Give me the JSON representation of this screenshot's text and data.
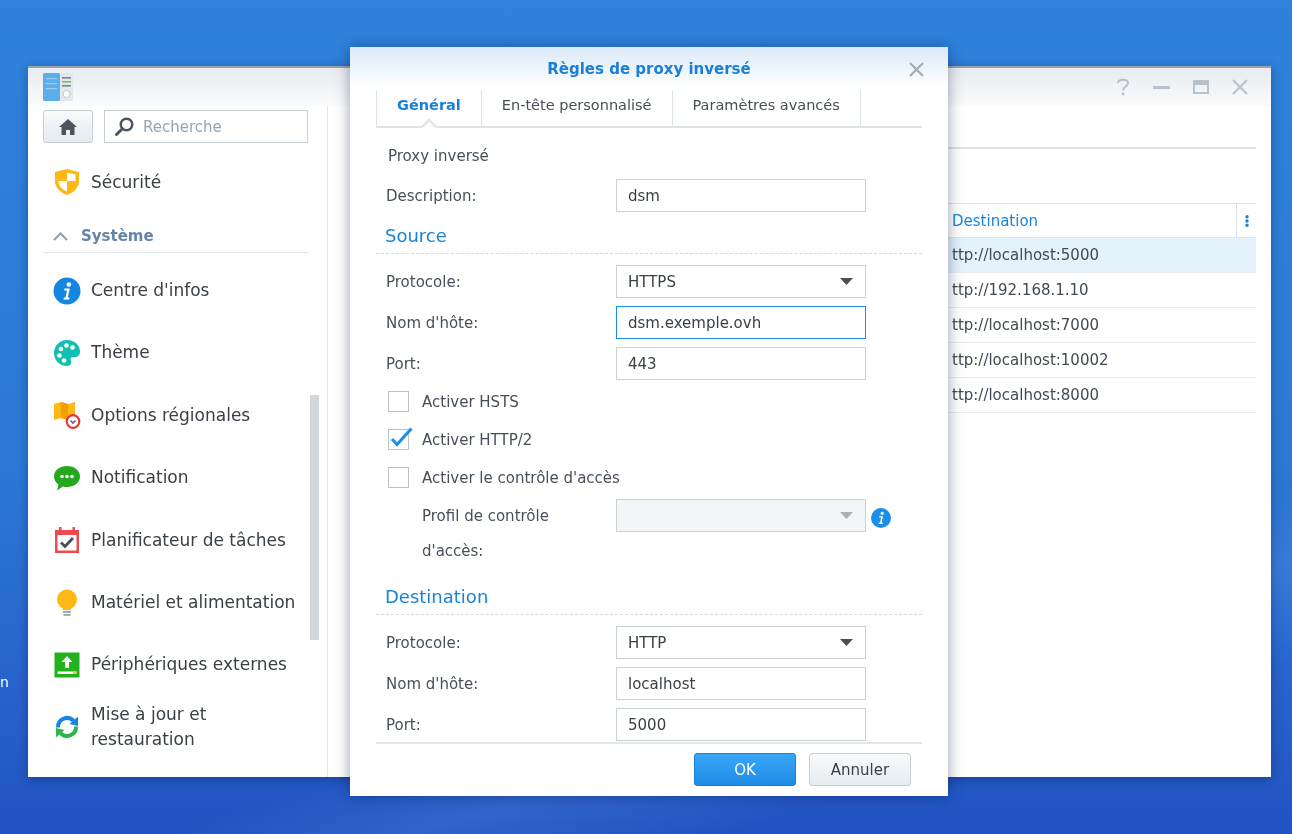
{
  "desktop": {
    "labels": [
      "n"
    ]
  },
  "main_window": {
    "search": {
      "placeholder": "Recherche"
    },
    "sidebar": {
      "items": [
        {
          "kind": "item",
          "label": "Sécurité"
        },
        {
          "kind": "header",
          "label": "Système",
          "expanded": true
        },
        {
          "kind": "item",
          "label": "Centre d'infos"
        },
        {
          "kind": "item",
          "label": "Thème"
        },
        {
          "kind": "item",
          "label": "Options régionales"
        },
        {
          "kind": "item",
          "label": "Notification"
        },
        {
          "kind": "item",
          "label": "Planificateur de tâches"
        },
        {
          "kind": "item",
          "label": "Matériel et alimentation"
        },
        {
          "kind": "item",
          "label": "Périphériques externes"
        },
        {
          "kind": "item",
          "label": "Mise à jour et restauration"
        }
      ]
    },
    "table": {
      "columns": [
        "Destination"
      ],
      "rows": [
        {
          "cells": [
            "ttp://localhost:5000"
          ],
          "selected": true
        },
        {
          "cells": [
            "ttp://192.168.1.10"
          ],
          "selected": false
        },
        {
          "cells": [
            "ttp://localhost:7000"
          ],
          "selected": false
        },
        {
          "cells": [
            "ttp://localhost:10002"
          ],
          "selected": false
        },
        {
          "cells": [
            "ttp://localhost:8000"
          ],
          "selected": false
        }
      ]
    }
  },
  "dialog": {
    "title": "Règles de proxy inversé",
    "tabs": [
      {
        "label": "Général",
        "selected": true
      },
      {
        "label": "En-tête personnalisé",
        "selected": false
      },
      {
        "label": "Paramètres avancés",
        "selected": false
      }
    ],
    "groups": [
      {
        "kind": "plain",
        "title": "Proxy inversé",
        "rows": [
          {
            "kind": "input",
            "label": "Description:",
            "value": "dsm",
            "focused": false,
            "disabled": false
          }
        ]
      },
      {
        "kind": "section",
        "title": "Source",
        "rows": [
          {
            "kind": "select",
            "label": "Protocole:",
            "value": "HTTPS",
            "focused": false,
            "disabled": false
          },
          {
            "kind": "input",
            "label": "Nom d'hôte:",
            "value": "dsm.exemple.ovh",
            "focused": true,
            "disabled": false
          },
          {
            "kind": "input",
            "label": "Port:",
            "value": "443",
            "focused": false,
            "disabled": false
          },
          {
            "kind": "checkbox",
            "label": "Activer HSTS",
            "checked": false
          },
          {
            "kind": "checkbox",
            "label": "Activer HTTP/2",
            "checked": true
          },
          {
            "kind": "checkbox",
            "label": "Activer le contrôle d'accès",
            "checked": false
          },
          {
            "kind": "subselect",
            "label": "Profil de contrôle d'accès:",
            "focused": false,
            "disabled": true
          }
        ]
      },
      {
        "kind": "section",
        "title": "Destination",
        "rows": [
          {
            "kind": "select",
            "label": "Protocole:",
            "value": "HTTP",
            "focused": false,
            "disabled": false
          },
          {
            "kind": "input",
            "label": "Nom d'hôte:",
            "value": "localhost",
            "focused": false,
            "disabled": false
          },
          {
            "kind": "input",
            "label": "Port:",
            "value": "5000",
            "focused": false,
            "disabled": false
          }
        ]
      }
    ],
    "buttons": [
      {
        "label": "OK",
        "kind": "primary"
      },
      {
        "label": "Annuler",
        "kind": "secondary"
      }
    ]
  }
}
